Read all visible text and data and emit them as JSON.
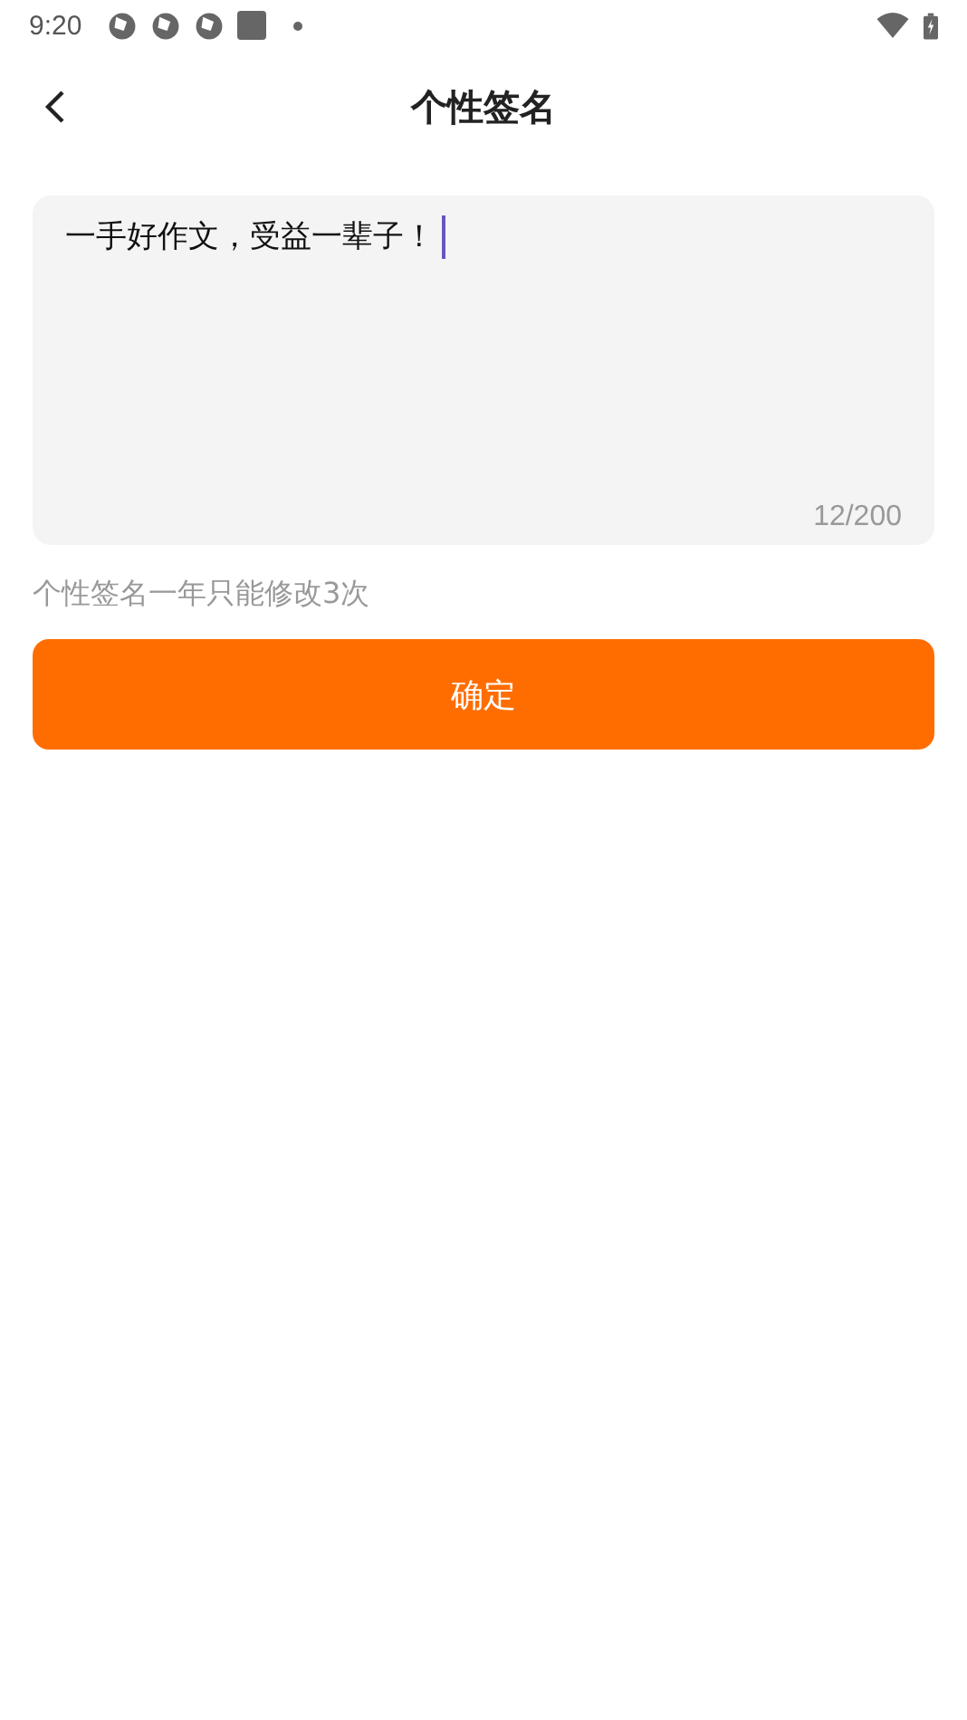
{
  "status_bar": {
    "time": "9:20"
  },
  "header": {
    "title": "个性签名"
  },
  "signature": {
    "value": "一手好作文，受益一辈子！",
    "counter": "12/200",
    "focused": true
  },
  "hint": "个性签名一年只能修改3次",
  "confirm_button": {
    "label": "确定"
  }
}
